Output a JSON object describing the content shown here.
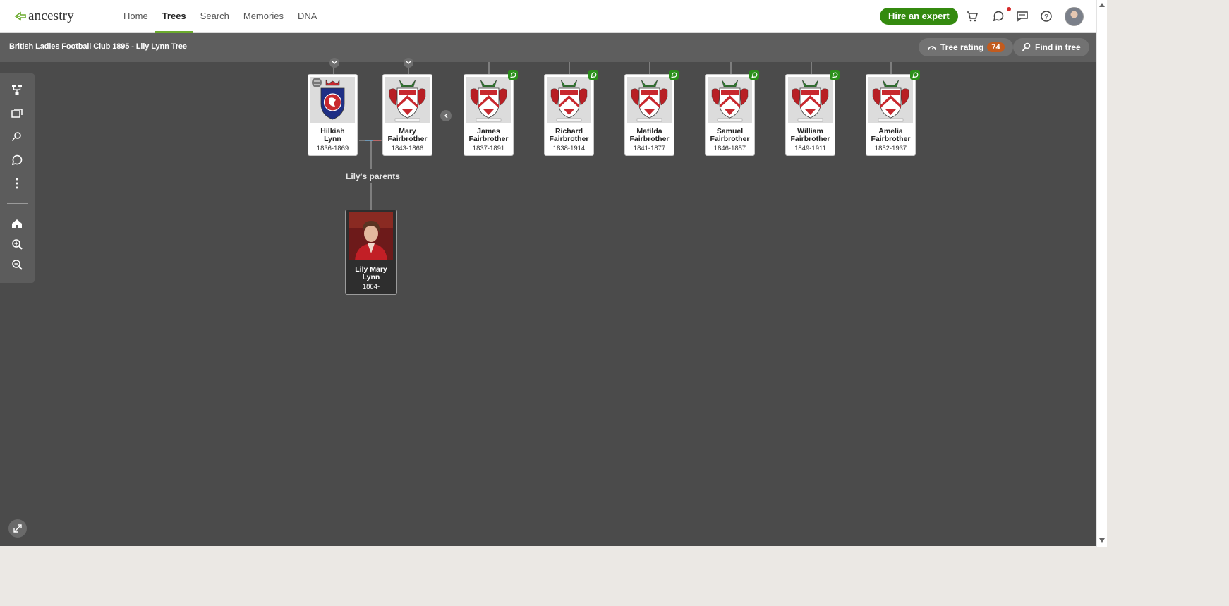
{
  "nav": {
    "logo_text": "ancestry",
    "items": [
      {
        "label": "Home",
        "active": false
      },
      {
        "label": "Trees",
        "active": true
      },
      {
        "label": "Search",
        "active": false
      },
      {
        "label": "Memories",
        "active": false
      },
      {
        "label": "DNA",
        "active": false
      }
    ],
    "hire_label": "Hire an expert",
    "icons": [
      "cart-icon",
      "hints-icon",
      "messages-icon",
      "help-icon",
      "user-avatar"
    ]
  },
  "tree": {
    "title": "British Ladies Football Club 1895 - Lily Lynn Tree",
    "rating_label": "Tree rating",
    "rating_value": "74",
    "find_label": "Find in tree",
    "parents_label": "Lily's parents"
  },
  "toolbar": {
    "icons": [
      "tree-view-icon",
      "media-icon",
      "search-person-icon",
      "hints-icon",
      "more-options-icon",
      "home-person-icon",
      "zoom-in-icon",
      "zoom-out-icon"
    ]
  },
  "people": [
    {
      "name": "Hilkiah Lynn",
      "line1": "Hilkiah",
      "line2": "Lynn",
      "dates": "1836-1869",
      "crest": "blue-lion"
    },
    {
      "name": "Mary Fairbrother",
      "line1": "Mary",
      "line2": "Fairbrother",
      "dates": "1843-1866",
      "crest": "red-chevron"
    },
    {
      "name": "James Fairbrother",
      "line1": "James",
      "line2": "Fairbrother",
      "dates": "1837-1891",
      "crest": "red-chevron"
    },
    {
      "name": "Richard Fairbrother",
      "line1": "Richard",
      "line2": "Fairbrother",
      "dates": "1838-1914",
      "crest": "red-chevron"
    },
    {
      "name": "Matilda Fairbrother",
      "line1": "Matilda",
      "line2": "Fairbrother",
      "dates": "1841-1877",
      "crest": "red-chevron"
    },
    {
      "name": "Samuel Fairbrother",
      "line1": "Samuel",
      "line2": "Fairbrother",
      "dates": "1846-1857",
      "crest": "red-chevron"
    },
    {
      "name": "William Fairbrother",
      "line1": "William",
      "line2": "Fairbrother",
      "dates": "1849-1911",
      "crest": "red-chevron"
    },
    {
      "name": "Amelia Fairbrother",
      "line1": "Amelia",
      "line2": "Fairbrother",
      "dates": "1852-1937",
      "crest": "red-chevron"
    }
  ],
  "focus_person": {
    "line1": "Lily Mary",
    "line2": "Lynn",
    "dates": "1864-"
  },
  "colors": {
    "accent_green": "#348a0f",
    "hint_green": "#2b8f1b",
    "canvas": "#4b4b4b",
    "rating_badge": "#c25b1e"
  }
}
